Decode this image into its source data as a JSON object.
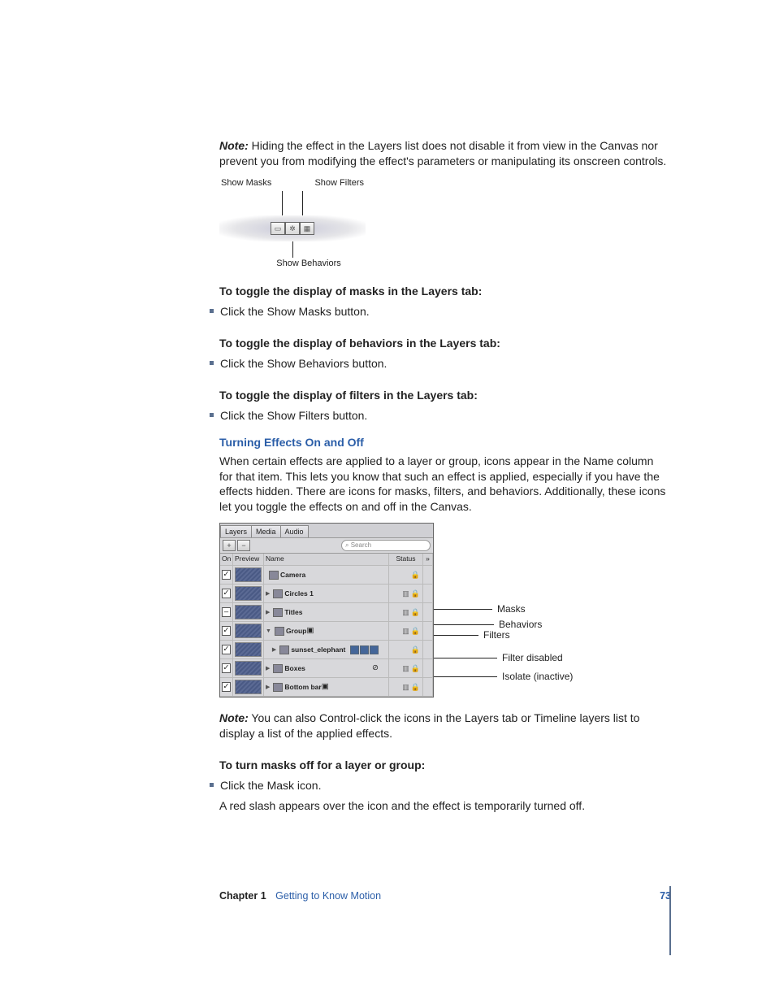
{
  "note1": {
    "prefix": "Note:",
    "text": "Hiding the effect in the Layers list does not disable it from view in the Canvas nor prevent you from modifying the effect's parameters or manipulating its onscreen controls."
  },
  "figure1": {
    "label_left": "Show Masks",
    "label_right": "Show Filters",
    "label_bottom": "Show Behaviors"
  },
  "task1": {
    "heading": "To toggle the display of masks in the Layers tab:",
    "bullet": "Click the Show Masks button."
  },
  "task2": {
    "heading": "To toggle the display of behaviors in the Layers tab:",
    "bullet": "Click the Show Behaviors button."
  },
  "task3": {
    "heading": "To toggle the display of filters in the Layers tab:",
    "bullet": "Click the Show Filters button."
  },
  "section2": {
    "head": "Turning Effects On and Off",
    "para": "When certain effects are applied to a layer or group, icons appear in the Name column for that item. This lets you know that such an effect is applied, especially if you have the effects hidden. There are icons for masks, filters, and behaviors. Additionally, these icons let you toggle the effects on and off in the Canvas."
  },
  "panel": {
    "tabs": [
      "Layers",
      "Media",
      "Audio"
    ],
    "toolbar": {
      "add": "+",
      "remove": "−",
      "search_icon": "⌕",
      "search_placeholder": "Search"
    },
    "headers": {
      "on": "On",
      "preview": "Preview",
      "name": "Name",
      "status": "Status",
      "arrow": "»"
    },
    "rows": [
      {
        "check": "✓",
        "tri": "",
        "icon": "🎥",
        "name": "Camera",
        "extra": "",
        "status": "🔒"
      },
      {
        "check": "✓",
        "tri": "▶",
        "icon": "🗂",
        "name": "Circles 1",
        "extra": "",
        "status": "▥ 🔒"
      },
      {
        "check": "–",
        "tri": "▶",
        "icon": "🗂",
        "name": "Titles",
        "extra": "",
        "status": "▥ 🔒"
      },
      {
        "check": "✓",
        "tri": "▼",
        "icon": "🗂",
        "name": "Group",
        "extra": "▣",
        "status": "▥ 🔒"
      },
      {
        "check": "✓",
        "tri": "▶",
        "icon": "🟦",
        "name": "sunset_elephant",
        "extra": "cluster",
        "status": "🔒",
        "indent": true
      },
      {
        "check": "✓",
        "tri": "▶",
        "icon": "🗂",
        "name": "Boxes",
        "extra": "",
        "status": "▥ 🔒",
        "filter_off": "⊘"
      },
      {
        "check": "✓",
        "tri": "▶",
        "icon": "🗂",
        "name": "Bottom bar",
        "extra": "▣",
        "status": "▥ 🔒"
      }
    ]
  },
  "callouts": {
    "masks": "Masks",
    "behaviors": "Behaviors",
    "filters": "Filters",
    "filter_disabled": "Filter disabled",
    "isolate_inactive": "Isolate (inactive)"
  },
  "note2": {
    "prefix": "Note:",
    "text": "You can also Control-click the icons in the Layers tab or Timeline layers list to display a list of the applied effects."
  },
  "task4": {
    "heading": "To turn masks off for a layer or group:",
    "bullet": "Click the Mask icon.",
    "after": "A red slash appears over the icon and the effect is temporarily turned off."
  },
  "footer": {
    "chapter_num": "Chapter 1",
    "chapter_title": "Getting to Know Motion",
    "page": "73"
  }
}
